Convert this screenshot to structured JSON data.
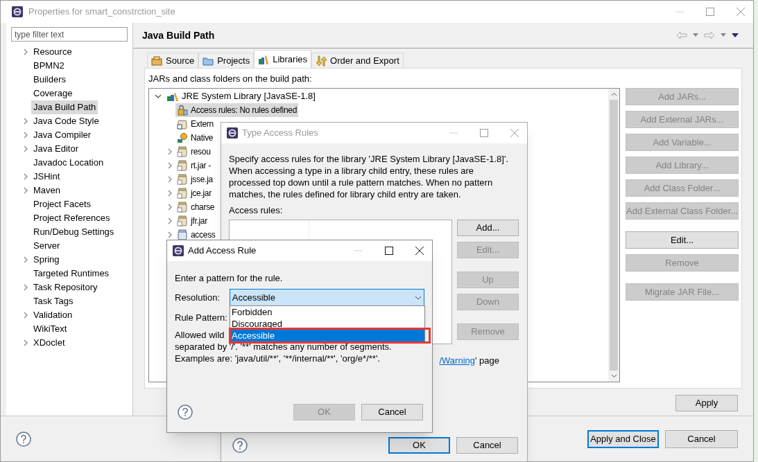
{
  "window": {
    "title": "Properties for smart_constrction_site"
  },
  "filter": {
    "placeholder": "type filter text"
  },
  "sidebar": {
    "items": [
      {
        "label": "Resource",
        "expandable": true,
        "selected": false
      },
      {
        "label": "BPMN2",
        "expandable": false,
        "selected": false
      },
      {
        "label": "Builders",
        "expandable": false,
        "selected": false
      },
      {
        "label": "Coverage",
        "expandable": false,
        "selected": false
      },
      {
        "label": "Java Build Path",
        "expandable": false,
        "selected": true
      },
      {
        "label": "Java Code Style",
        "expandable": true,
        "selected": false
      },
      {
        "label": "Java Compiler",
        "expandable": true,
        "selected": false
      },
      {
        "label": "Java Editor",
        "expandable": true,
        "selected": false
      },
      {
        "label": "Javadoc Location",
        "expandable": false,
        "selected": false
      },
      {
        "label": "JSHint",
        "expandable": true,
        "selected": false
      },
      {
        "label": "Maven",
        "expandable": true,
        "selected": false
      },
      {
        "label": "Project Facets",
        "expandable": false,
        "selected": false
      },
      {
        "label": "Project References",
        "expandable": false,
        "selected": false
      },
      {
        "label": "Run/Debug Settings",
        "expandable": false,
        "selected": false
      },
      {
        "label": "Server",
        "expandable": false,
        "selected": false
      },
      {
        "label": "Spring",
        "expandable": true,
        "selected": false
      },
      {
        "label": "Targeted Runtimes",
        "expandable": false,
        "selected": false
      },
      {
        "label": "Task Repository",
        "expandable": true,
        "selected": false
      },
      {
        "label": "Task Tags",
        "expandable": false,
        "selected": false
      },
      {
        "label": "Validation",
        "expandable": true,
        "selected": false
      },
      {
        "label": "WikiText",
        "expandable": false,
        "selected": false
      },
      {
        "label": "XDoclet",
        "expandable": true,
        "selected": false
      }
    ]
  },
  "page": {
    "title": "Java Build Path"
  },
  "tabs": [
    {
      "label": "Source",
      "kind": "source",
      "selected": false
    },
    {
      "label": "Projects",
      "kind": "projects",
      "selected": false
    },
    {
      "label": "Libraries",
      "kind": "libraries",
      "selected": true
    },
    {
      "label": "Order and Export",
      "kind": "order",
      "selected": false
    }
  ],
  "libraries": {
    "caption": "JARs and class folders on the build path:",
    "tree": [
      {
        "label": "JRE System Library [JavaSE-1.8]",
        "expanded": true,
        "children": [
          {
            "label": "Access rules: No rules defined",
            "kind": "rules",
            "expandable": false,
            "selected": true
          },
          {
            "label": "Extern",
            "kind": "annotations",
            "expandable": false,
            "selected": false
          },
          {
            "label": "Native",
            "kind": "native",
            "expandable": false,
            "selected": false
          },
          {
            "label": "resou",
            "kind": "jar",
            "expandable": true,
            "selected": false
          },
          {
            "label": "rt.jar -",
            "kind": "jar",
            "expandable": true,
            "selected": false
          },
          {
            "label": "jsse.ja",
            "kind": "jar",
            "expandable": true,
            "selected": false
          },
          {
            "label": "jce.jar",
            "kind": "jar",
            "expandable": true,
            "selected": false
          },
          {
            "label": "charse",
            "kind": "jar",
            "expandable": true,
            "selected": false
          },
          {
            "label": "jfr.jar",
            "kind": "jar",
            "expandable": true,
            "selected": false
          },
          {
            "label": "access",
            "kind": "binary",
            "expandable": true,
            "selected": false
          }
        ]
      }
    ]
  },
  "side_button_groups": [
    [
      {
        "label": "Add JARs...",
        "disabled": true
      },
      {
        "label": "Add External JARs...",
        "disabled": true
      },
      {
        "label": "Add Variable...",
        "disabled": true
      },
      {
        "label": "Add Library...",
        "disabled": true
      },
      {
        "label": "Add Class Folder...",
        "disabled": true
      },
      {
        "label": "Add External Class Folder...",
        "disabled": true
      }
    ],
    [
      {
        "label": "Edit...",
        "disabled": false
      },
      {
        "label": "Remove",
        "disabled": true
      }
    ],
    [
      {
        "label": "Migrate JAR File...",
        "disabled": true
      }
    ]
  ],
  "apply_button": "Apply",
  "footer_buttons": [
    {
      "label": "Apply and Close",
      "default": true
    },
    {
      "label": "Cancel",
      "default": false
    }
  ],
  "type_access_rules": {
    "title": "Type Access Rules",
    "description": "Specify access rules for the library 'JRE System Library [JavaSE-1.8]'. When accessing a type in a library child entry, these rules are processed top down until a rule pattern matches. When no pattern matches, the rules defined for library child entry are taken.",
    "rules_label": "Access rules:",
    "button_groups": [
      [
        {
          "label": "Add...",
          "disabled": false
        },
        {
          "label": "Edit...",
          "disabled": true
        }
      ],
      [
        {
          "label": "Up",
          "disabled": true
        },
        {
          "label": "Down",
          "disabled": true
        }
      ],
      [
        {
          "label": "Remove",
          "disabled": true
        }
      ]
    ],
    "note_link": "/Warning",
    "note_text": "' page",
    "footer_buttons": [
      {
        "label": "OK",
        "default": true
      },
      {
        "label": "Cancel",
        "default": false
      }
    ]
  },
  "add_access_rule": {
    "title": "Add Access Rule",
    "prompt": "Enter a pattern for the rule.",
    "resolution_label": "Resolution:",
    "resolution_value": "Accessible",
    "options": [
      {
        "label": "Forbidden",
        "selected": false
      },
      {
        "label": "Discouraged",
        "selected": false
      },
      {
        "label": "Accessible",
        "selected": true
      }
    ],
    "pattern_label": "Rule Pattern:",
    "help_lines": [
      "Allowed wild",
      "separated by '/'. '**' matches any number of segments.",
      "Examples are: 'java/util/**', '**/internal/**', 'org/e*/**'."
    ],
    "footer_buttons": [
      {
        "label": "OK",
        "disabled": true
      },
      {
        "label": "Cancel",
        "disabled": false
      }
    ]
  }
}
